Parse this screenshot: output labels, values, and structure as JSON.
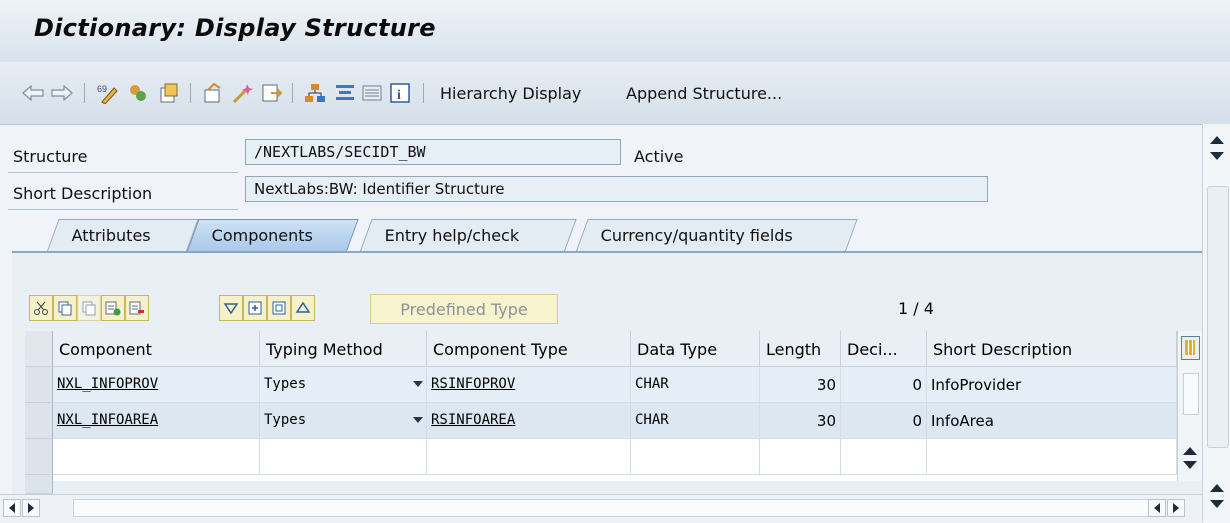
{
  "title": "Dictionary: Display Structure",
  "toolbar": {
    "icons": [
      "back-arrow-icon",
      "forward-arrow-icon",
      "other-object-icon",
      "display-change-icon",
      "activate-icon",
      "check-icon",
      "where-used-icon",
      "object-list-icon",
      "navigation-window-icon",
      "hierarchy-icon",
      "technical-settings-icon",
      "info-icon"
    ],
    "hierarchy_display": "Hierarchy Display",
    "append_structure": "Append Structure..."
  },
  "header": {
    "structure_label": "Structure",
    "structure_value": "/NEXTLABS/SECIDT_BW",
    "status": "Active",
    "short_desc_label": "Short Description",
    "short_desc_value": "NextLabs:BW: Identifier Structure"
  },
  "tabs": [
    {
      "label": "Attributes",
      "active": false
    },
    {
      "label": "Components",
      "active": true
    },
    {
      "label": "Entry help/check",
      "active": false
    },
    {
      "label": "Currency/quantity fields",
      "active": false
    }
  ],
  "table_toolbar": {
    "predefined_type": "Predefined Type",
    "page_indicator": "1 / 4"
  },
  "table": {
    "columns": [
      "Component",
      "Typing Method",
      "Component Type",
      "Data Type",
      "Length",
      "Deci...",
      "Short Description"
    ],
    "rows": [
      {
        "component": "NXL_INFOPROV",
        "typing": "Types",
        "comp_type": "RSINFOPROV",
        "data_type": "CHAR",
        "length": "30",
        "decimals": "0",
        "short_desc": "InfoProvider"
      },
      {
        "component": "NXL_INFOAREA",
        "typing": "Types",
        "comp_type": "RSINFOAREA",
        "data_type": "CHAR",
        "length": "30",
        "decimals": "0",
        "short_desc": "InfoArea"
      }
    ]
  },
  "colors": {
    "active_tab": "#a9c9ea",
    "button_bg": "#f5f1c8",
    "field_bg": "#e6eef6"
  }
}
